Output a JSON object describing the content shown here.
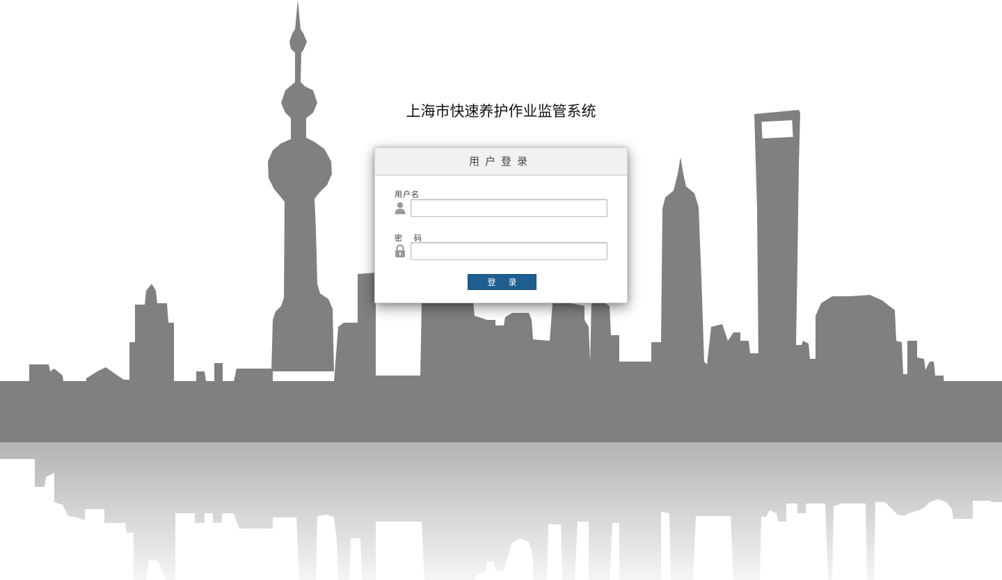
{
  "app": {
    "title": "上海市快速养护作业监管系统"
  },
  "login_panel": {
    "header": "用户登录",
    "username_label": "用户名",
    "username_value": "",
    "password_label_first": "密",
    "password_label_second": "码",
    "password_value": "",
    "button_label_first": "登",
    "button_label_second": "录"
  },
  "icons": {
    "username": "user-icon",
    "password": "lock-icon"
  },
  "colors": {
    "skyline": "#7f7f7f",
    "reflection_top": "#b5b5b5",
    "reflection_bottom": "#f4f4f4",
    "button": "#1e5d8f",
    "panel_header": "#f1f1f1"
  }
}
